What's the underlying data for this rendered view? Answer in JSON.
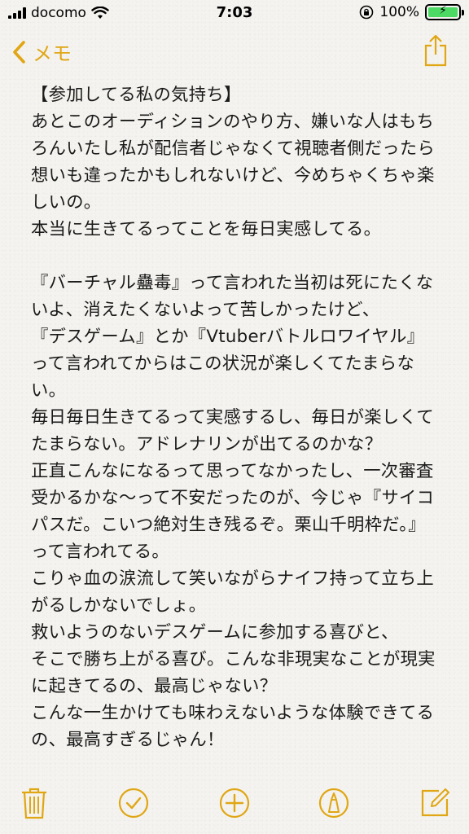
{
  "status_bar": {
    "carrier": "docomo",
    "time": "7:03",
    "battery_percent": "100%",
    "battery_level": 1.0
  },
  "nav": {
    "back_label": "メモ",
    "back_icon": "chevron-left-icon",
    "share_icon": "share-icon"
  },
  "note": {
    "lines": [
      "【参加してる私の気持ち】",
      "あとこのオーディションのやり方、嫌いな人はもち",
      "ろんいたし私が配信者じゃなくて視聴者側だったら",
      "想いも違ったかもしれないけど、今めちゃくちゃ楽",
      "しいの。",
      "本当に生きてるってことを毎日実感してる。",
      "",
      "『バーチャル蠱毒』って言われた当初は死にたくな",
      "いよ、消えたくないよって苦しかったけど、",
      "『デスゲーム』とか『Vtuberバトルロワイヤル』",
      "って言われてからはこの状況が楽しくてたまらな",
      "い。",
      "毎日毎日生きてるって実感するし、毎日が楽しくて",
      "たまらない。アドレナリンが出てるのかな？",
      "正直こんなになるって思ってなかったし、一次審査",
      "受かるかな〜って不安だったのが、今じゃ『サイコ",
      "パスだ。こいつ絶対生き残るぞ。栗山千明枠だ。』",
      "って言われてる。",
      "こりゃ血の涙流して笑いながらナイフ持って立ち上",
      "がるしかないでしょ。",
      "救いようのないデスゲームに参加する喜びと、",
      "そこで勝ち上がる喜び。こんな非現実なことが現実",
      "に起きてるの、最高じゃない？",
      "こんな一生かけても味わえないような体験できてる",
      "の、最高すぎるじゃん！"
    ]
  },
  "toolbar": {
    "icons": [
      "trash-icon",
      "checklist-icon",
      "add-icon",
      "markup-icon",
      "compose-icon"
    ]
  },
  "colors": {
    "accent": "#e0a614",
    "battery": "#4cd964"
  }
}
